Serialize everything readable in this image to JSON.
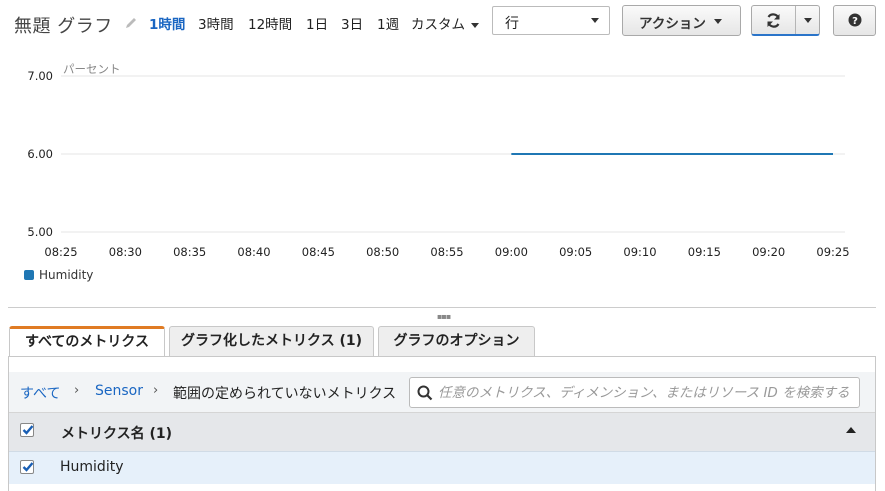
{
  "toolbar": {
    "title": "無題 グラフ",
    "ranges": [
      "1時間",
      "3時間",
      "12時間",
      "1日",
      "3日",
      "1週"
    ],
    "active_range": "1時間",
    "custom_label": "カスタム",
    "view_select_value": "行",
    "actions_label": "アクション",
    "icons": {
      "edit": "pencil-icon",
      "refresh": "refresh-icon",
      "help": "help-icon"
    }
  },
  "chart_data": {
    "type": "line",
    "ylabel": "パーセント",
    "ylim": [
      5.0,
      7.0
    ],
    "yticks": [
      "7.00",
      "6.00",
      "5.00"
    ],
    "x": [
      "08:25",
      "08:30",
      "08:35",
      "08:40",
      "08:45",
      "08:50",
      "08:55",
      "09:00",
      "09:05",
      "09:10",
      "09:15",
      "09:20",
      "09:25"
    ],
    "series": [
      {
        "name": "Humidity",
        "color": "#1f77b4",
        "start": "09:00",
        "end": "09:25",
        "values": [
          6.0,
          6.0
        ]
      }
    ],
    "grid": true,
    "legend": "bottom-left"
  },
  "tabs": [
    {
      "label": "すべてのメトリクス",
      "active": true
    },
    {
      "label": "グラフ化したメトリクス (1)",
      "active": false
    },
    {
      "label": "グラフのオプション",
      "active": false
    }
  ],
  "breadcrumb": [
    "すべて",
    "Sensor",
    "範囲の定められていないメトリクス"
  ],
  "search": {
    "placeholder": "任意のメトリクス、ディメンション、またはリソース ID を検索する"
  },
  "table": {
    "header": "メトリクス名 (1)",
    "rows": [
      {
        "name": "Humidity",
        "checked": true
      }
    ]
  },
  "colors": {
    "accent": "#1a66c2",
    "tab_active": "#e07b23",
    "series": "#1f77b4"
  }
}
